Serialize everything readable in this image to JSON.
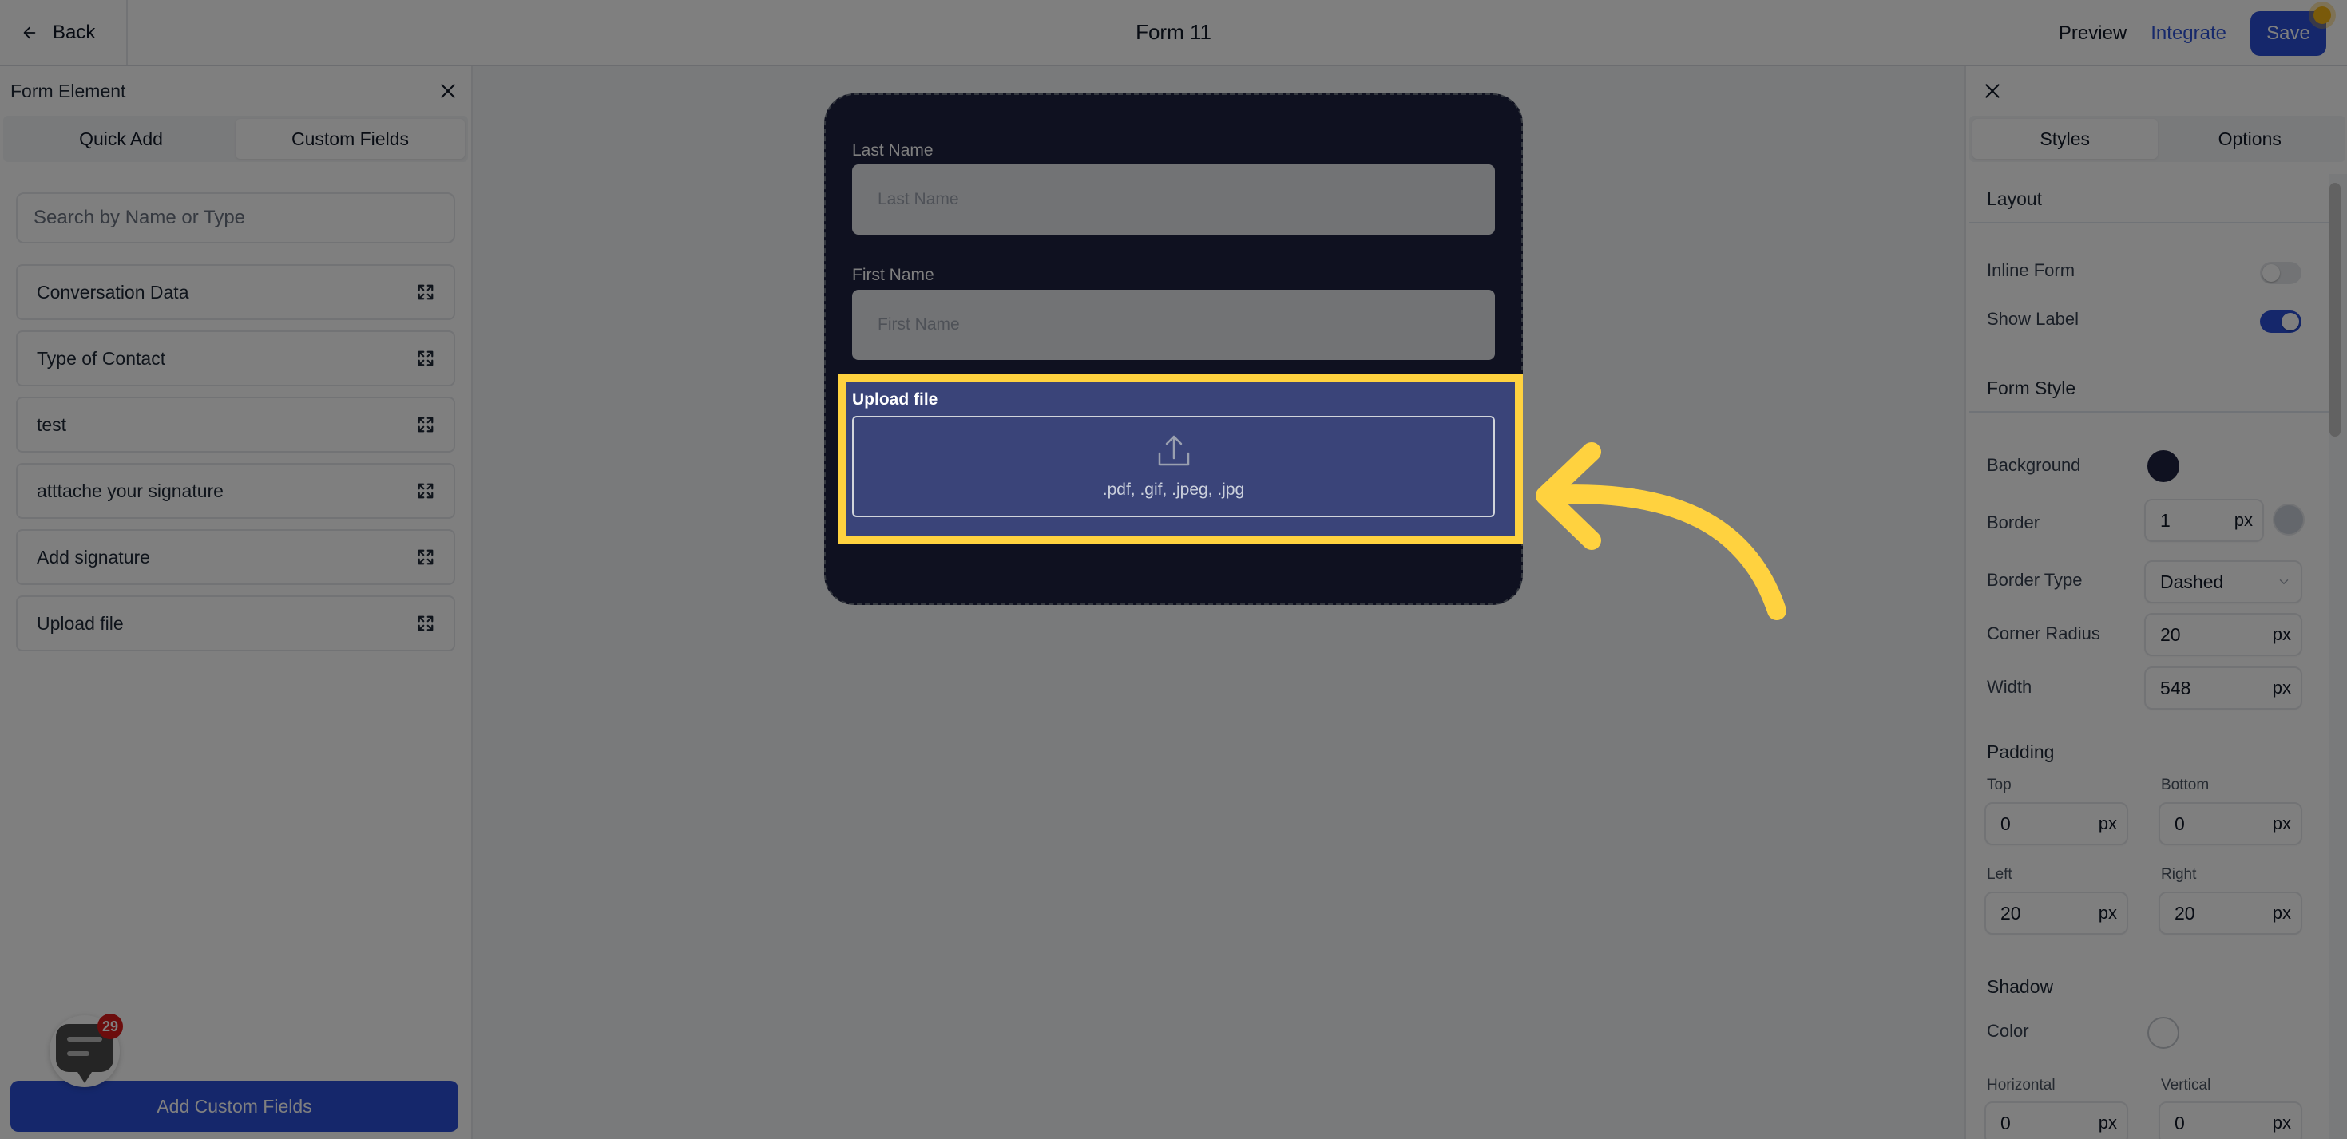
{
  "topbar": {
    "back_label": "Back",
    "title": "Form 11",
    "preview_label": "Preview",
    "integrate_label": "Integrate",
    "save_label": "Save"
  },
  "left_panel": {
    "title": "Form Element",
    "tabs": [
      {
        "label": "Quick Add",
        "active": false
      },
      {
        "label": "Custom Fields",
        "active": true
      }
    ],
    "search_placeholder": "Search by Name or Type",
    "items": [
      {
        "label": "Conversation Data"
      },
      {
        "label": "Type of Contact"
      },
      {
        "label": "test"
      },
      {
        "label": "atttache your signature"
      },
      {
        "label": "Add signature"
      },
      {
        "label": "Upload file"
      }
    ],
    "add_button_label": "Add Custom Fields",
    "chat_badge_count": "29"
  },
  "form": {
    "fields": [
      {
        "label": "Last Name",
        "placeholder": "Last Name"
      },
      {
        "label": "First Name",
        "placeholder": "First Name"
      }
    ],
    "upload": {
      "label": "Upload file",
      "accepted_types": ".pdf, .gif, .jpeg, .jpg"
    }
  },
  "right_panel": {
    "tabs": [
      {
        "label": "Styles",
        "active": true
      },
      {
        "label": "Options",
        "active": false
      }
    ],
    "layout": {
      "heading": "Layout",
      "inline_form_label": "Inline Form",
      "inline_form_on": false,
      "show_label_label": "Show Label",
      "show_label_on": true
    },
    "form_style": {
      "heading": "Form Style",
      "background_label": "Background",
      "background_color": "#1e2240",
      "border_label": "Border",
      "border_value": "1",
      "border_color": "#c9cfd8",
      "border_type_label": "Border Type",
      "border_type_value": "Dashed",
      "corner_radius_label": "Corner Radius",
      "corner_radius_value": "20",
      "width_label": "Width",
      "width_value": "548",
      "unit": "px"
    },
    "padding": {
      "heading": "Padding",
      "top_label": "Top",
      "top_value": "0",
      "bottom_label": "Bottom",
      "bottom_value": "0",
      "left_label": "Left",
      "left_value": "20",
      "right_label": "Right",
      "right_value": "20"
    },
    "shadow": {
      "heading": "Shadow",
      "color_label": "Color",
      "color_value": "#ffffff",
      "horizontal_label": "Horizontal",
      "horizontal_value": "0",
      "vertical_label": "Vertical",
      "vertical_value": "0"
    }
  },
  "colors": {
    "accent": "#2a4fd6",
    "highlight": "#ffd23f",
    "form_background": "#1e2240"
  }
}
